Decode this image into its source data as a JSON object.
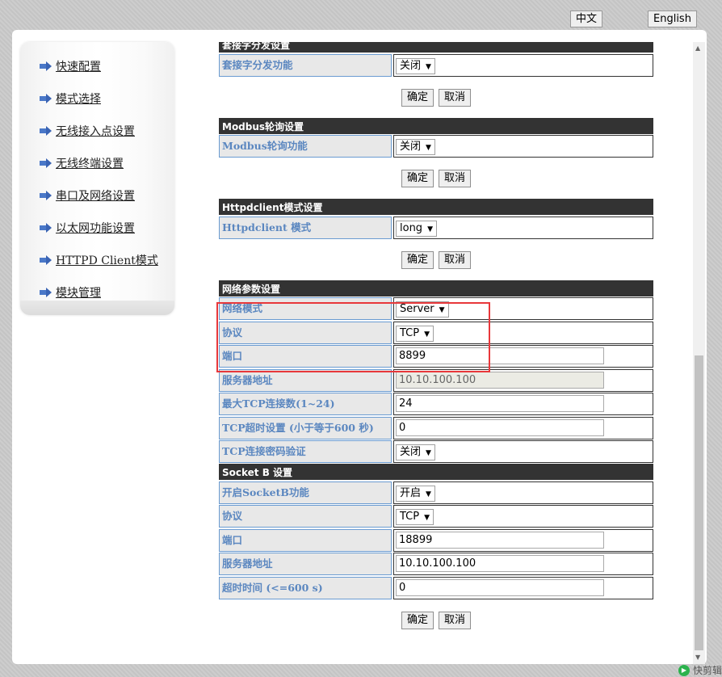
{
  "header": {
    "lang_zh": "中文",
    "lang_en": "English"
  },
  "sidebar": {
    "items": [
      {
        "label": "快速配置"
      },
      {
        "label": "模式选择"
      },
      {
        "label": "无线接入点设置"
      },
      {
        "label": "无线终端设置"
      },
      {
        "label": "串口及网络设置"
      },
      {
        "label": "以太网功能设置"
      },
      {
        "label": "HTTPD Client模式"
      },
      {
        "label": "模块管理"
      }
    ]
  },
  "sections": [
    {
      "title": "套接字分发设置",
      "rows": [
        {
          "label": "套接字分发功能",
          "type": "select",
          "value": "关闭"
        }
      ],
      "buttons": true
    },
    {
      "title": "Modbus轮询设置",
      "rows": [
        {
          "label": "Modbus轮询功能",
          "type": "select",
          "value": "关闭"
        }
      ],
      "buttons": true
    },
    {
      "title": "Httpdclient模式设置",
      "rows": [
        {
          "label": "Httpdclient 模式",
          "type": "select",
          "value": "long"
        }
      ],
      "buttons": true,
      "gap_after": true
    },
    {
      "title": "网络参数设置",
      "rows": [
        {
          "label": "网络模式",
          "type": "select",
          "value": "Server"
        },
        {
          "label": "协议",
          "type": "select",
          "value": "TCP"
        },
        {
          "label": "端口",
          "type": "input",
          "value": "8899"
        },
        {
          "label": "服务器地址",
          "type": "readonly",
          "value": "10.10.100.100"
        },
        {
          "label": "最大TCP连接数(1~24)",
          "type": "input",
          "value": "24"
        },
        {
          "label": "TCP超时设置 (小于等于600 秒)",
          "type": "input",
          "value": "0"
        },
        {
          "label": "TCP连接密码验证",
          "type": "select",
          "value": "关闭"
        }
      ],
      "buttons": false
    },
    {
      "title": "Socket B 设置",
      "rows": [
        {
          "label": "开启SocketB功能",
          "type": "select",
          "value": "开启"
        },
        {
          "label": "协议",
          "type": "select",
          "value": "TCP"
        },
        {
          "label": "端口",
          "type": "input",
          "value": "18899"
        },
        {
          "label": "服务器地址",
          "type": "input",
          "value": "10.10.100.100"
        },
        {
          "label": "超时时间 (<=600 s)",
          "type": "input",
          "value": "0"
        }
      ],
      "buttons": true
    }
  ],
  "buttons": {
    "confirm": "确定",
    "cancel": "取消"
  },
  "footer": {
    "watermark": "快剪辑"
  },
  "colors": {
    "highlight": "#e8383b",
    "header_bg": "#333333",
    "label_text": "#5b87c0"
  }
}
